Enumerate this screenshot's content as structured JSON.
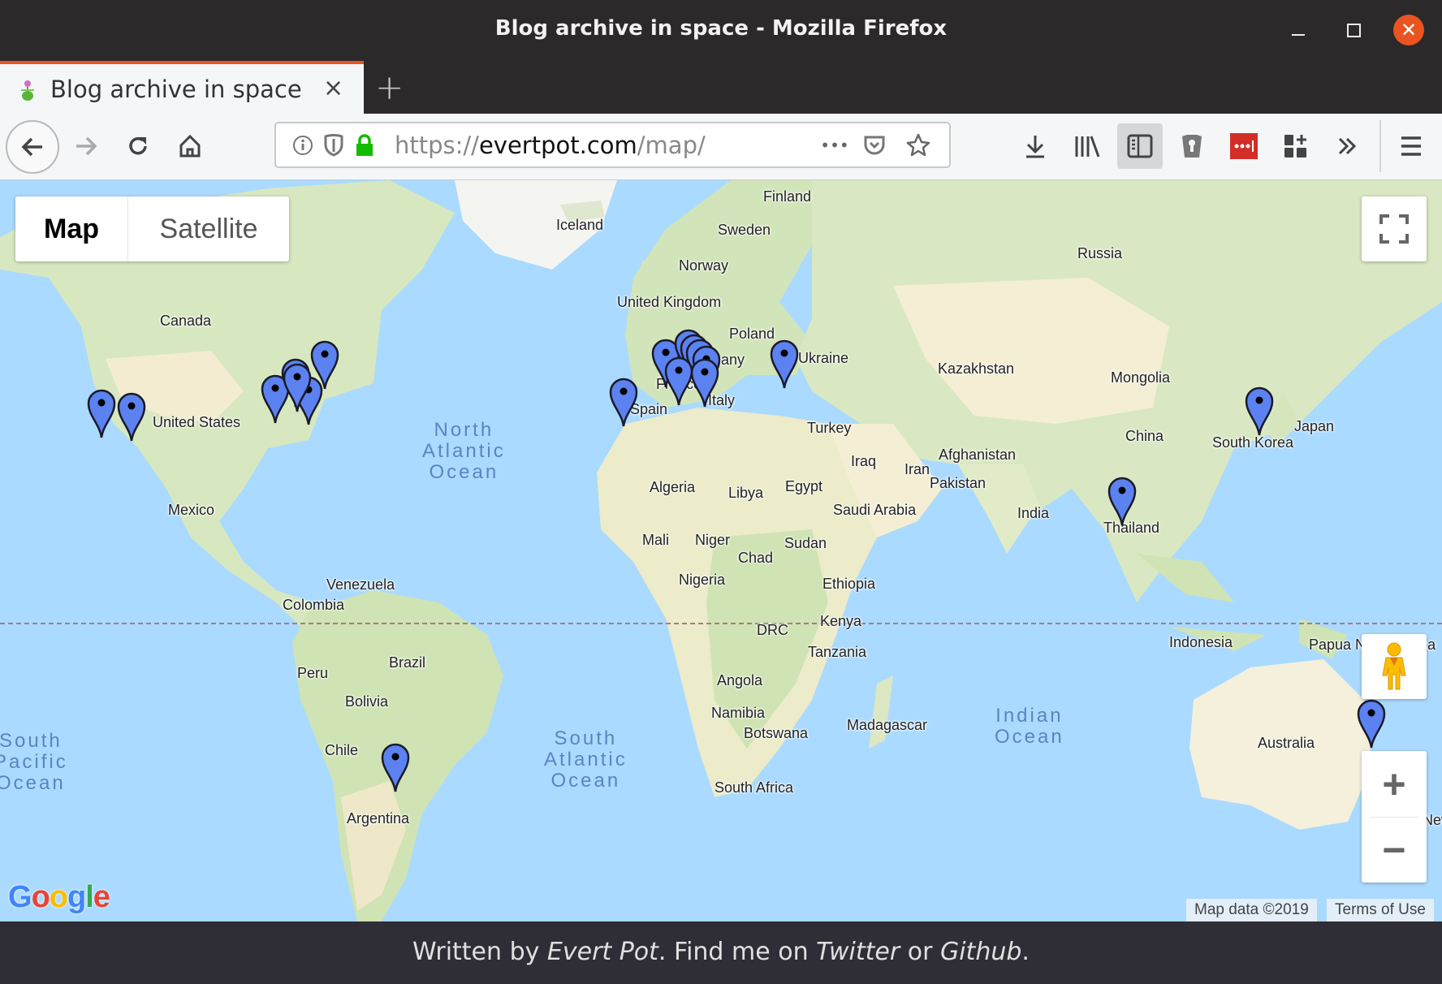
{
  "window": {
    "title": "Blog archive in space - Mozilla Firefox"
  },
  "tab": {
    "title": "Blog archive in space",
    "close_label": "×",
    "new_tab_label": "+"
  },
  "urlbar": {
    "scheme": "https://",
    "host": "evertpot.com",
    "path": "/map/",
    "more_label": "•••"
  },
  "map": {
    "type_buttons": [
      {
        "label": "Map",
        "selected": true
      },
      {
        "label": "Satellite",
        "selected": false
      }
    ],
    "country_labels": [
      "Finland",
      "Iceland",
      "Sweden",
      "Norway",
      "Russia",
      "United Kingdom",
      "Poland",
      "Germany",
      "Ukraine",
      "France",
      "Italy",
      "Spain",
      "Kazakhstan",
      "Mongolia",
      "Turkey",
      "China",
      "Japan",
      "South Korea",
      "Iraq",
      "Iran",
      "Afghanistan",
      "Pakistan",
      "Algeria",
      "Libya",
      "Egypt",
      "Saudi Arabia",
      "India",
      "Thailand",
      "Mali",
      "Niger",
      "Chad",
      "Sudan",
      "Nigeria",
      "Ethiopia",
      "Kenya",
      "DRC",
      "Tanzania",
      "Indonesia",
      "Papua New Guinea",
      "Angola",
      "Namibia",
      "Botswana",
      "Madagascar",
      "South Africa",
      "Australia",
      "New Zealand",
      "Canada",
      "United States",
      "Mexico",
      "Venezuela",
      "Colombia",
      "Peru",
      "Brazil",
      "Bolivia",
      "Chile",
      "Argentina"
    ],
    "ocean_labels": [
      "North\nAtlantic\nOcean",
      "South\nAtlantic\nOcean",
      "Indian\nOcean",
      "South\nPacific\nOcean"
    ],
    "markers": [
      "California 1",
      "California 2",
      "Great Lakes",
      "Toronto",
      "Ontario",
      "New York",
      "Montreal",
      "Spain",
      "United Kingdom",
      "Netherlands 1",
      "Netherlands 2",
      "Netherlands 3",
      "Netherlands 4",
      "Belgium",
      "Germany",
      "Romania",
      "South Korea",
      "Thailand",
      "Argentina",
      "Australia"
    ],
    "marker_color": "#5b82f0",
    "attribution": "Map data ©2019",
    "terms": "Terms of Use",
    "google_logo": "Google"
  },
  "footer": {
    "prefix": "Written by ",
    "author": "Evert Pot",
    "middle": ". Find me on ",
    "twitter": "Twitter",
    "or": " or ",
    "github": "Github",
    "suffix": "."
  },
  "colors": {
    "accent": "#e95420",
    "water": "#aadaff",
    "land": "#e8f0d8",
    "desert": "#f5f0dc",
    "footer_bg": "#2f2e36"
  }
}
